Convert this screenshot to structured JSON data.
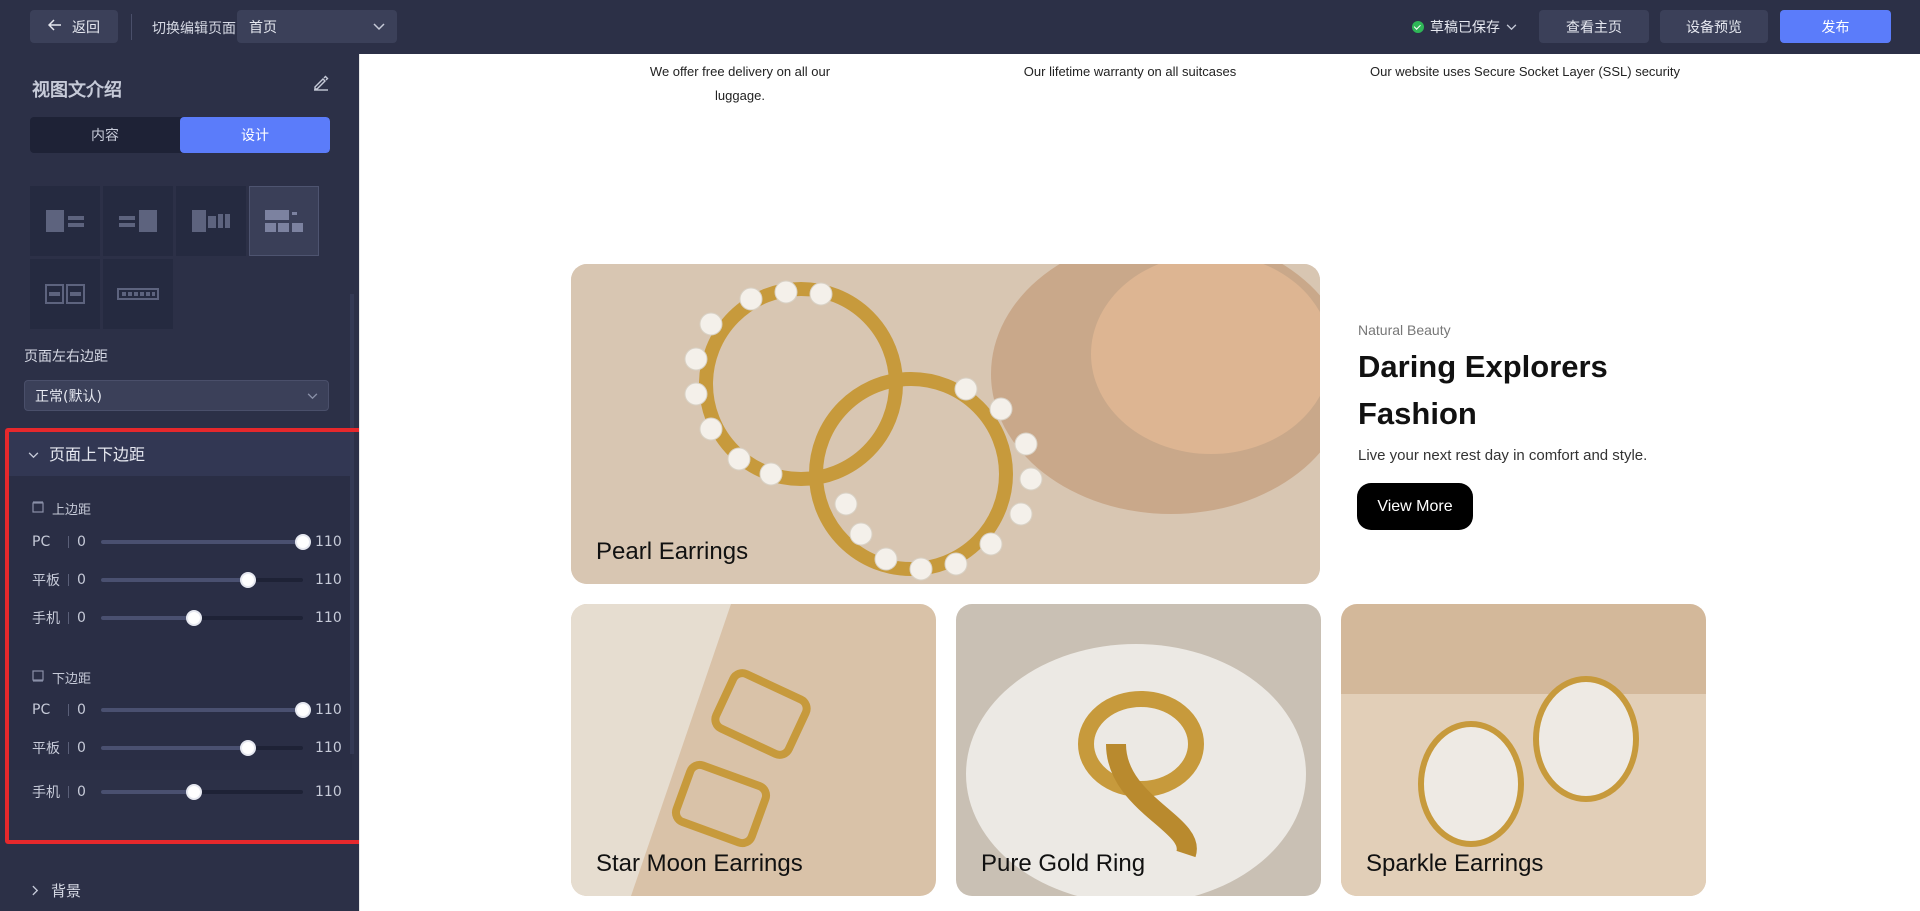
{
  "topbar": {
    "back_label": "返回",
    "switch_page_label": "切换编辑页面",
    "page_select_value": "首页",
    "save_status": "草稿已保存",
    "view_home_label": "查看主页",
    "device_preview_label": "设备预览",
    "publish_label": "发布"
  },
  "sidebar": {
    "title": "视图文介绍",
    "tabs": [
      "内容",
      "设计"
    ],
    "active_tab": "设计",
    "margin_lr_label": "页面左右边距",
    "margin_lr_value": "正常(默认)",
    "section_title": "页面上下边距",
    "top_margin_label": "上边距",
    "bottom_margin_label": "下边距",
    "sliders": [
      {
        "device": "PC",
        "min": "0",
        "max": "110",
        "level": 1.0
      },
      {
        "device": "平板",
        "min": "0",
        "max": "110",
        "level": 0.73
      },
      {
        "device": "手机",
        "min": "0",
        "max": "110",
        "level": 0.46
      }
    ],
    "background_label": "背景"
  },
  "canvas": {
    "features": [
      "We offer free delivery on all our luggage.",
      "Our lifetime warranty on all suitcases",
      "Our website uses Secure Socket Layer (SSL) security"
    ],
    "hero_image_label": "Pearl Earrings",
    "eyebrow": "Natural Beauty",
    "headline": "Daring Explorers Fashion",
    "subtext": "Live your next rest day in comfort and style.",
    "cta_label": "View More",
    "cards": [
      {
        "label": "Star Moon Earrings"
      },
      {
        "label": "Pure Gold Ring"
      },
      {
        "label": "Sparkle Earrings"
      }
    ]
  },
  "colors": {
    "primary": "#5b7cfa",
    "sidebar_bg": "#2c3047",
    "highlight": "#e6282c",
    "status_ok": "#2fb657"
  }
}
